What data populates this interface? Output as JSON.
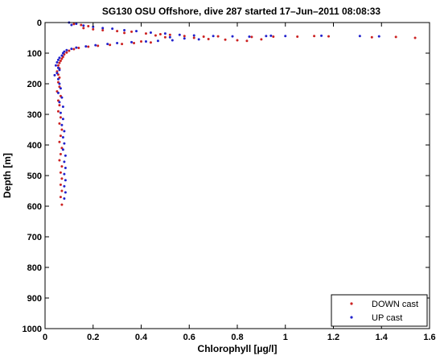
{
  "chart_data": {
    "type": "scatter",
    "title": "SG130 OSU Offshore, dive 287 started 17–Jun–2011 08:08:33",
    "xlabel": "Chlorophyll [µg/l]",
    "ylabel": "Depth [m]",
    "xlim": [
      0,
      1.6
    ],
    "ylim": [
      1000,
      0
    ],
    "y_reversed": true,
    "grid": false,
    "legend_position": "bottom-right",
    "xticks": [
      0,
      0.2,
      0.4,
      0.6,
      0.8,
      1,
      1.2,
      1.4,
      1.6
    ],
    "xtick_labels": [
      "0",
      "0.2",
      "0.4",
      "0.6",
      "0.8",
      "1",
      "1.2",
      "1.4",
      "1.6"
    ],
    "yticks": [
      0,
      100,
      200,
      300,
      400,
      500,
      600,
      700,
      800,
      900,
      1000
    ],
    "ytick_labels": [
      "0",
      "100",
      "200",
      "300",
      "400",
      "500",
      "600",
      "700",
      "800",
      "900",
      "1000"
    ],
    "series": [
      {
        "name": "DOWN cast",
        "color": "#cc2222",
        "points": [
          [
            0.12,
            5
          ],
          [
            0.15,
            8
          ],
          [
            0.18,
            12
          ],
          [
            0.16,
            18
          ],
          [
            0.2,
            22
          ],
          [
            0.24,
            25
          ],
          [
            0.3,
            28
          ],
          [
            0.36,
            30
          ],
          [
            0.33,
            34
          ],
          [
            0.42,
            36
          ],
          [
            0.48,
            38
          ],
          [
            0.52,
            40
          ],
          [
            0.46,
            42
          ],
          [
            0.58,
            44
          ],
          [
            0.66,
            46
          ],
          [
            0.72,
            45
          ],
          [
            0.86,
            47
          ],
          [
            0.95,
            46
          ],
          [
            1.05,
            46
          ],
          [
            1.12,
            44
          ],
          [
            1.18,
            45
          ],
          [
            1.36,
            48
          ],
          [
            1.46,
            47
          ],
          [
            1.54,
            50
          ],
          [
            0.5,
            48
          ],
          [
            0.62,
            50
          ],
          [
            0.68,
            54
          ],
          [
            0.75,
            56
          ],
          [
            0.8,
            58
          ],
          [
            0.84,
            60
          ],
          [
            0.9,
            55
          ],
          [
            0.4,
            62
          ],
          [
            0.44,
            65
          ],
          [
            0.37,
            67
          ],
          [
            0.32,
            70
          ],
          [
            0.27,
            73
          ],
          [
            0.22,
            76
          ],
          [
            0.18,
            79
          ],
          [
            0.14,
            83
          ],
          [
            0.12,
            87
          ],
          [
            0.1,
            92
          ],
          [
            0.09,
            98
          ],
          [
            0.08,
            104
          ],
          [
            0.075,
            112
          ],
          [
            0.07,
            118
          ],
          [
            0.065,
            125
          ],
          [
            0.06,
            132
          ],
          [
            0.055,
            140
          ],
          [
            0.06,
            150
          ],
          [
            0.05,
            160
          ],
          [
            0.055,
            170
          ],
          [
            0.06,
            180
          ],
          [
            0.055,
            195
          ],
          [
            0.06,
            210
          ],
          [
            0.05,
            225
          ],
          [
            0.065,
            240
          ],
          [
            0.055,
            255
          ],
          [
            0.06,
            270
          ],
          [
            0.055,
            290
          ],
          [
            0.065,
            310
          ],
          [
            0.06,
            330
          ],
          [
            0.07,
            350
          ],
          [
            0.065,
            370
          ],
          [
            0.06,
            390
          ],
          [
            0.07,
            410
          ],
          [
            0.065,
            430
          ],
          [
            0.06,
            450
          ],
          [
            0.07,
            470
          ],
          [
            0.065,
            490
          ],
          [
            0.07,
            510
          ],
          [
            0.065,
            530
          ],
          [
            0.07,
            550
          ],
          [
            0.065,
            570
          ],
          [
            0.07,
            595
          ]
        ]
      },
      {
        "name": "UP cast",
        "color": "#2222cc",
        "points": [
          [
            0.1,
            0
          ],
          [
            0.13,
            4
          ],
          [
            0.11,
            8
          ],
          [
            0.16,
            10
          ],
          [
            0.2,
            14
          ],
          [
            0.24,
            18
          ],
          [
            0.28,
            20
          ],
          [
            0.33,
            25
          ],
          [
            0.38,
            28
          ],
          [
            0.44,
            33
          ],
          [
            0.5,
            36
          ],
          [
            0.56,
            40
          ],
          [
            0.62,
            42
          ],
          [
            0.7,
            44
          ],
          [
            0.78,
            45
          ],
          [
            0.85,
            46
          ],
          [
            0.92,
            44
          ],
          [
            0.94,
            43
          ],
          [
            1.0,
            44
          ],
          [
            1.15,
            43
          ],
          [
            1.31,
            44
          ],
          [
            1.39,
            45
          ],
          [
            0.52,
            48
          ],
          [
            0.58,
            52
          ],
          [
            0.64,
            55
          ],
          [
            0.53,
            58
          ],
          [
            0.47,
            60
          ],
          [
            0.42,
            62
          ],
          [
            0.36,
            64
          ],
          [
            0.3,
            67
          ],
          [
            0.26,
            70
          ],
          [
            0.21,
            74
          ],
          [
            0.17,
            78
          ],
          [
            0.13,
            82
          ],
          [
            0.11,
            86
          ],
          [
            0.09,
            90
          ],
          [
            0.08,
            95
          ],
          [
            0.075,
            100
          ],
          [
            0.07,
            108
          ],
          [
            0.06,
            115
          ],
          [
            0.055,
            122
          ],
          [
            0.05,
            130
          ],
          [
            0.045,
            140
          ],
          [
            0.055,
            148
          ],
          [
            0.06,
            155
          ],
          [
            0.05,
            165
          ],
          [
            0.04,
            172
          ],
          [
            0.055,
            185
          ],
          [
            0.06,
            200
          ],
          [
            0.065,
            215
          ],
          [
            0.055,
            230
          ],
          [
            0.07,
            245
          ],
          [
            0.06,
            260
          ],
          [
            0.075,
            275
          ],
          [
            0.065,
            295
          ],
          [
            0.075,
            315
          ],
          [
            0.07,
            335
          ],
          [
            0.08,
            355
          ],
          [
            0.075,
            375
          ],
          [
            0.08,
            395
          ],
          [
            0.075,
            415
          ],
          [
            0.085,
            435
          ],
          [
            0.08,
            455
          ],
          [
            0.085,
            475
          ],
          [
            0.08,
            495
          ],
          [
            0.085,
            515
          ],
          [
            0.08,
            535
          ],
          [
            0.085,
            555
          ],
          [
            0.08,
            575
          ]
        ]
      }
    ]
  }
}
